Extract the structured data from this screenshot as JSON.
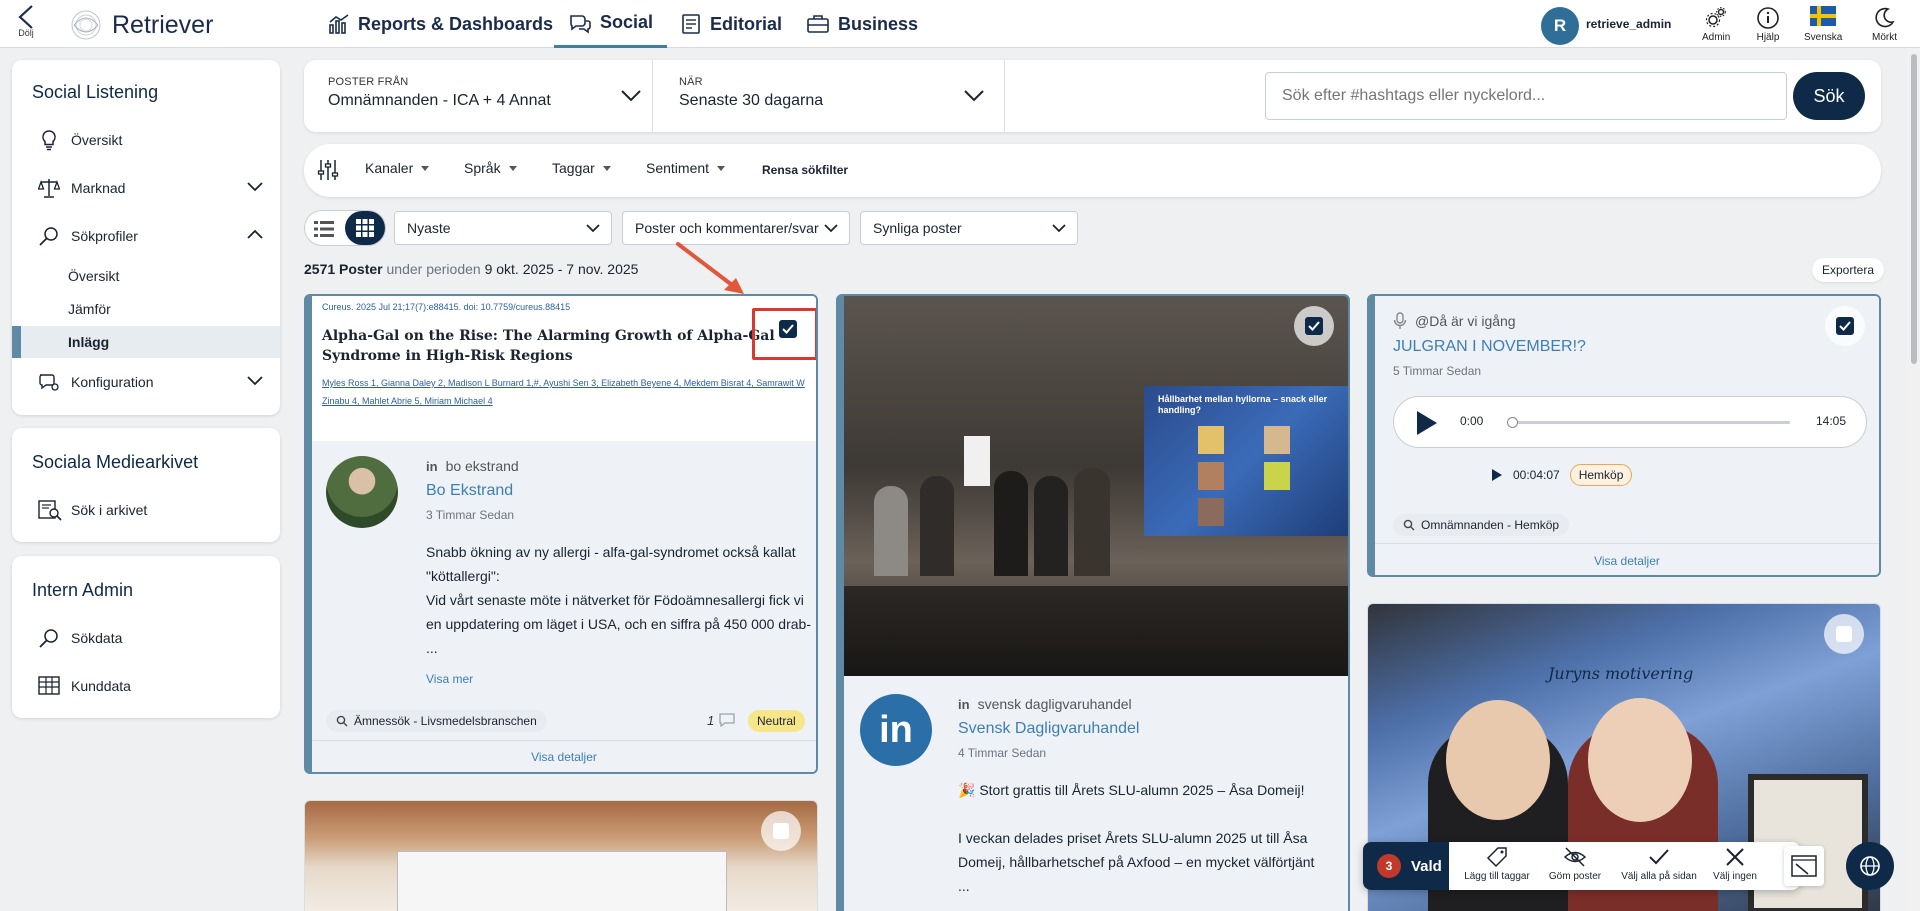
{
  "topbar": {
    "hide_label": "Dölj",
    "logo_text": "Retriever",
    "nav": [
      {
        "label": "Reports & Dashboards"
      },
      {
        "label": "Social"
      },
      {
        "label": "Editorial"
      },
      {
        "label": "Business"
      }
    ],
    "avatar_initial": "R",
    "username": "retrieve_admin",
    "admin_label": "Admin",
    "help_label": "Hjälp",
    "language_label": "Svenska",
    "theme_label": "Mörkt"
  },
  "sidebar": {
    "social_listening": {
      "title": "Social Listening",
      "items": [
        {
          "label": "Översikt"
        },
        {
          "label": "Marknad"
        },
        {
          "label": "Sökprofiler"
        },
        {
          "label": "Konfiguration"
        }
      ],
      "subitems": [
        {
          "label": "Översikt"
        },
        {
          "label": "Jämför"
        },
        {
          "label": "Inlägg"
        }
      ]
    },
    "archive": {
      "title": "Sociala Mediearkivet",
      "items": [
        {
          "label": "Sök i arkivet"
        }
      ]
    },
    "admin": {
      "title": "Intern Admin",
      "items": [
        {
          "label": "Sökdata"
        },
        {
          "label": "Kunddata"
        }
      ]
    }
  },
  "filters": {
    "posts_from_label": "POSTER FRÅN",
    "posts_from_value": "Omnämnanden - ICA + 4 Annat",
    "when_label": "NÄR",
    "when_value": "Senaste 30 dagarna",
    "search_placeholder": "Sök efter #hashtags eller nyckelord...",
    "search_button": "Sök",
    "channels": "Kanaler",
    "language": "Språk",
    "tags": "Taggar",
    "sentiment": "Sentiment",
    "clear": "Rensa sökfilter",
    "sort": "Nyaste",
    "post_type": "Poster och kommentarer/svar",
    "visibility": "Synliga poster"
  },
  "summary": {
    "count": "2571 Poster",
    "period_text": "under perioden",
    "period": "9 okt. 2025 - 7 nov. 2025",
    "export": "Exportera"
  },
  "cards": {
    "c1": {
      "article_source": "Cureus. 2025 Jul 21;17(7):e88415. doi: 10.7759/cureus.88415",
      "article_title": "Alpha-Gal on the Rise: The Alarming Growth of Alpha-Gal Syndrome in High-Risk Regions",
      "article_authors": "Myles Ross 1, Gianna Daley 2, Madison L Burnard 1,#, Ayushi Sen 3, Elizabeth Beyene 4, Mekdem Bisrat 4, Samrawit W Zinabu 4, Mahlet Abrie 5, Miriam Michael 4",
      "handle": "bo ekstrand",
      "author": "Bo Ekstrand",
      "time": "3 Timmar Sedan",
      "text_1": "Snabb ökning av ny allergi - alfa-gal-syndromet också kallat \"köttallergi\":",
      "text_2": "Vid vårt senaste möte i nätverket för Födoämnesallergi fick vi en uppdatering om läget i USA, och en siffra på 450 000 drab-",
      "ellipsis": "...",
      "more": "Visa mer",
      "tag": "Ämnessök - Livsmedelsbranschen",
      "comments": "1",
      "sentiment": "Neutral",
      "details": "Visa detaljer"
    },
    "c2": {
      "slide_title": "Hållbarhet mellan hyllorna – snack eller handling?",
      "handle": "svensk dagligvaruhandel",
      "author": "Svensk Dagligvaruhandel",
      "time": "4 Timmar Sedan",
      "text_1": "🎉 Stort grattis till Årets SLU-alumn 2025 – Åsa Domeij!",
      "text_2": "I veckan delades priset Årets SLU-alumn 2025 ut till Åsa Domeij, hållbarhetschef på Axfood – en mycket välförtjänt",
      "ellipsis": "..."
    },
    "c3": {
      "handle": "@Då är vi igång",
      "title": "JULGRAN I NOVEMBER!?",
      "time": "5 Timmar Sedan",
      "audio_current": "0:00",
      "audio_total": "14:05",
      "audio_progress": 0.0,
      "clip_time": "00:04:07",
      "clip_tag": "Hemköp",
      "tag": "Omnämnanden - Hemköp",
      "details": "Visa detaljer"
    },
    "c4": {
      "slide_heading": "Juryns motivering"
    }
  },
  "bottombar": {
    "selected_count": "3",
    "selected_label": "Vald",
    "add_tags": "Lägg till taggar",
    "hide_posts": "Göm poster",
    "select_all": "Välj alla på sidan",
    "select_none": "Välj ingen"
  },
  "colors": {
    "accent": "#3d7f9d",
    "selected_border": "#5e8aa6",
    "navy": "#0f2a48",
    "badge_red": "#c0392b",
    "neutral_badge": "#f7e58a"
  }
}
